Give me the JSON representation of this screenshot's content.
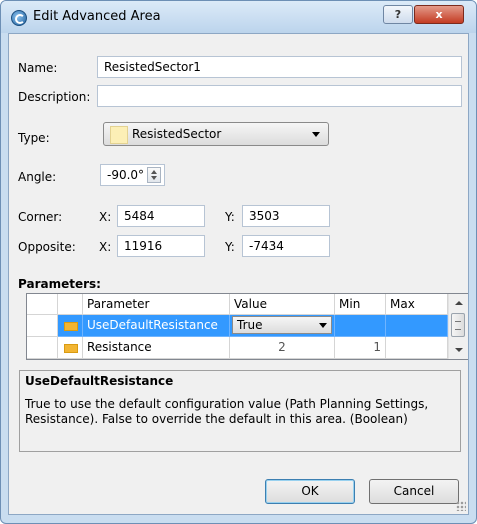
{
  "window": {
    "title": "Edit Advanced Area",
    "help_label": "?",
    "close_label": "x"
  },
  "form": {
    "name_label": "Name:",
    "name_value": "ResistedSector1",
    "description_label": "Description:",
    "description_value": "",
    "type_label": "Type:",
    "type_value": "ResistedSector",
    "type_swatch_color": "#fcefb6",
    "angle_label": "Angle:",
    "angle_value": "-90.0°",
    "corner_label": "Corner:",
    "corner_x_label": "X:",
    "corner_x": "5484",
    "corner_y_label": "Y:",
    "corner_y": "3503",
    "opposite_label": "Opposite:",
    "opposite_x_label": "X:",
    "opposite_x": "11916",
    "opposite_y_label": "Y:",
    "opposite_y": "-7434"
  },
  "parameters": {
    "heading": "Parameters:",
    "columns": [
      "Parameter",
      "Value",
      "Min",
      "Max"
    ],
    "rows": [
      {
        "parameter": "UseDefaultResistance",
        "value": "True",
        "min": "",
        "max": "",
        "selected": true
      },
      {
        "parameter": "Resistance",
        "value": "2",
        "min": "1",
        "max": "",
        "selected": false
      }
    ]
  },
  "description_panel": {
    "title": "UseDefaultResistance",
    "text": "True to use the default configuration value (Path Planning Settings, Resistance). False to override the default in this area. (Boolean)"
  },
  "buttons": {
    "ok": "OK",
    "cancel": "Cancel"
  },
  "colors": {
    "selection": "#3399ff",
    "title_bar": "#c9ddf0",
    "close_button": "#c33b22"
  }
}
